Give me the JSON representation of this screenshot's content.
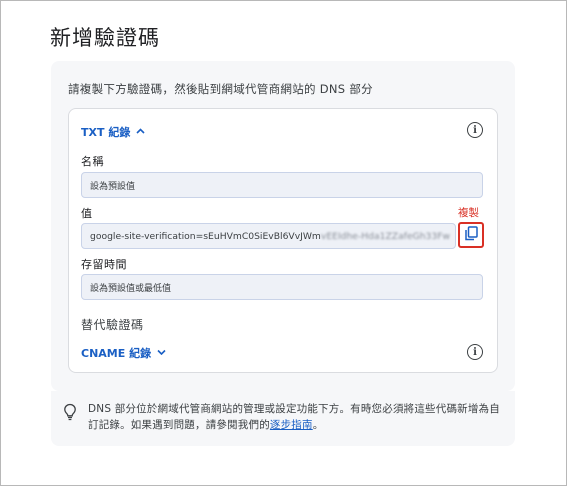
{
  "page": {
    "title": "新增驗證碼",
    "instruction": "請複製下方驗證碼，然後貼到網域代管商網站的 DNS 部分"
  },
  "txt_record": {
    "toggle_label": "TXT 紀錄",
    "toggle_icon": "chevron-up-icon",
    "name_label": "名稱",
    "name_value": "設為預設值",
    "value_label": "值",
    "value_visible": "google-site-verification=sEuHVmC0SiEvBl6VvJWm",
    "value_obscured": "vEEIdhe-Hda1ZZafeGh33Fw",
    "copy_label": "複製",
    "copy_icon": "copy-icon",
    "ttl_label": "存留時間",
    "ttl_value": "設為預設值或最低值"
  },
  "alternate": {
    "heading": "替代驗證碼",
    "toggle_label": "CNAME 紀錄",
    "toggle_icon": "chevron-down-icon"
  },
  "tip": {
    "icon": "lightbulb-icon",
    "text_before": "DNS 部分位於網域代管商網站的管理或設定功能下方。有時您必須將這些代碼新增為自訂記錄。如果遇到問題，請參閱我們的",
    "link_text": "逐步指南",
    "text_after": "。"
  },
  "colors": {
    "accent_blue": "#1a5fc4",
    "highlight_red": "#d93025",
    "panel_bg": "#f6f7f9",
    "input_bg": "#eef1f7"
  }
}
